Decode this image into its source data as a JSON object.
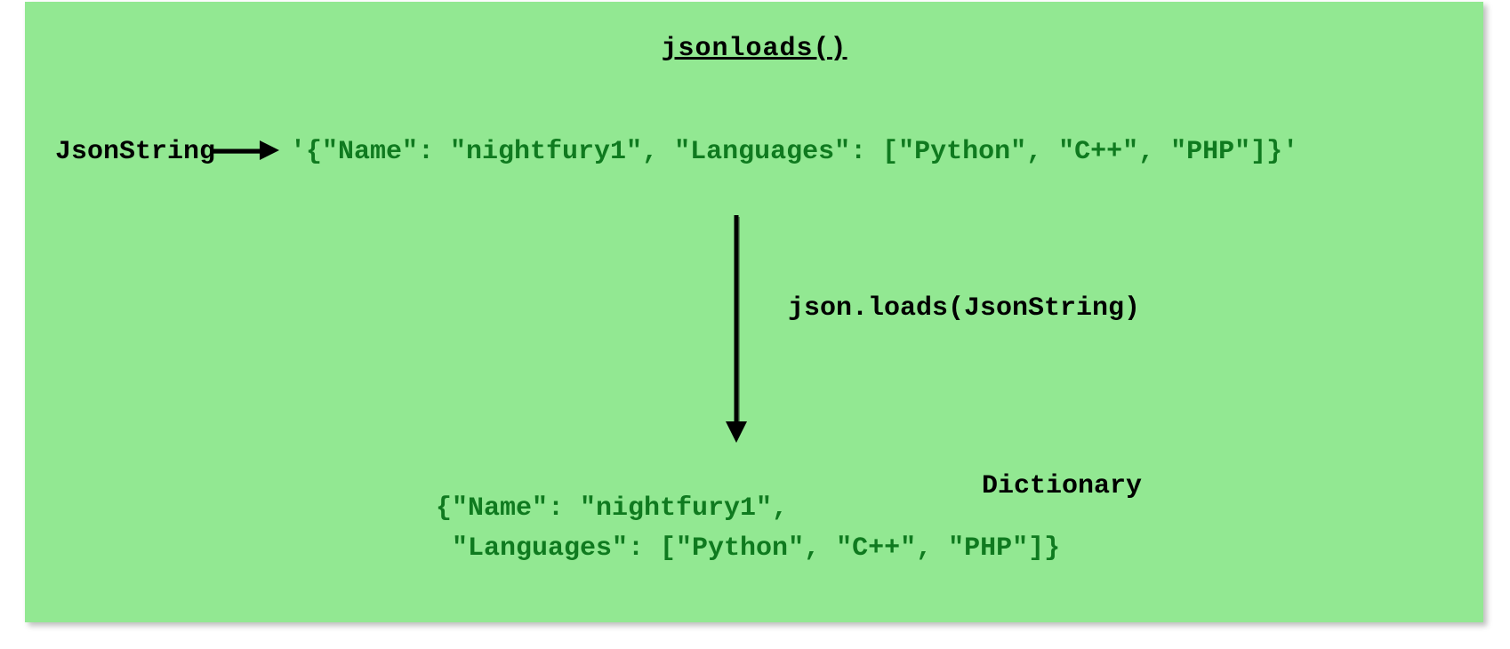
{
  "diagram": {
    "title": "jsonloads()",
    "input_label": "JsonString",
    "input_value": "'{\"Name\": \"nightfury1\", \"Languages\": [\"Python\", \"C++\", \"PHP\"]}'",
    "transform_label": "json.loads(JsonString)",
    "output_line1": "{\"Name\": \"nightfury1\",",
    "output_line2": " \"Languages\": [\"Python\", \"C++\", \"PHP\"]}",
    "output_label": "Dictionary"
  },
  "colors": {
    "background": "#92e892",
    "code_text": "#0f7a1f",
    "label_text": "#000000"
  }
}
